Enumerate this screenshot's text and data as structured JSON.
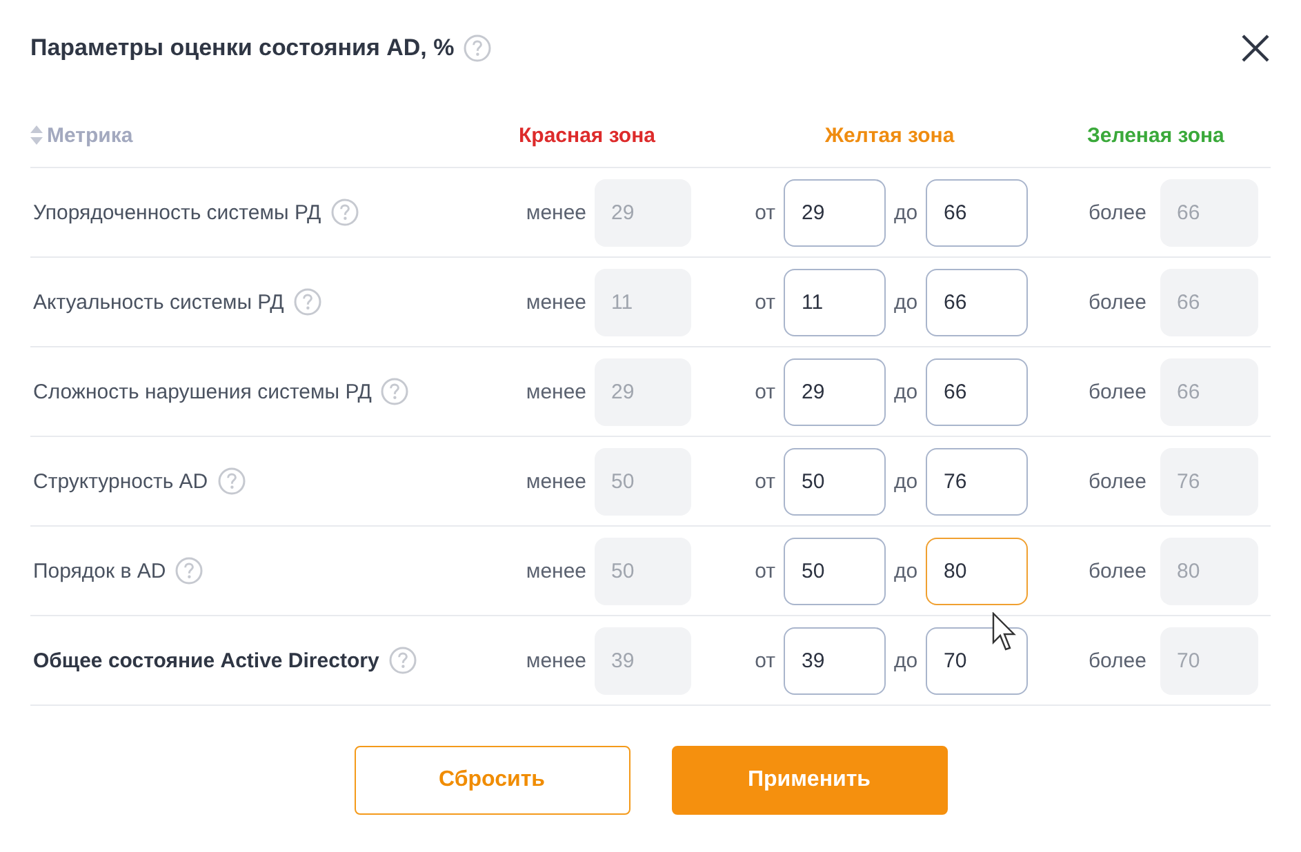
{
  "dialog": {
    "title": "Параметры оценки состояния AD, %"
  },
  "columns": [
    {
      "kind": "metric",
      "label": "Метрика"
    },
    {
      "kind": "red",
      "label": "Красная зона"
    },
    {
      "kind": "yellow",
      "label": "Желтая зона"
    },
    {
      "kind": "green",
      "label": "Зеленая зона"
    }
  ],
  "rows": [
    {
      "kind": "metric",
      "name": "Упорядоченность системы РД",
      "red_label": "менее",
      "red": "29",
      "from_label": "от",
      "from": "29",
      "to_label": "до",
      "to": "66",
      "to_focused": false,
      "green_label": "более",
      "green": "66"
    },
    {
      "kind": "metric",
      "name": "Актуальность системы РД",
      "red_label": "менее",
      "red": "11",
      "from_label": "от",
      "from": "11",
      "to_label": "до",
      "to": "66",
      "to_focused": false,
      "green_label": "более",
      "green": "66"
    },
    {
      "kind": "metric",
      "name": "Сложность нарушения системы РД",
      "red_label": "менее",
      "red": "29",
      "from_label": "от",
      "from": "29",
      "to_label": "до",
      "to": "66",
      "to_focused": false,
      "green_label": "более",
      "green": "66"
    },
    {
      "kind": "metric",
      "name": "Структурность AD",
      "red_label": "менее",
      "red": "50",
      "from_label": "от",
      "from": "50",
      "to_label": "до",
      "to": "76",
      "to_focused": false,
      "green_label": "более",
      "green": "76"
    },
    {
      "kind": "metric",
      "name": "Порядок в AD",
      "red_label": "менее",
      "red": "50",
      "from_label": "от",
      "from": "50",
      "to_label": "до",
      "to": "80",
      "to_focused": true,
      "green_label": "более",
      "green": "80"
    },
    {
      "kind": "total",
      "name": "Общее состояние Active Directory",
      "red_label": "менее",
      "red": "39",
      "from_label": "от",
      "from": "39",
      "to_label": "до",
      "to": "70",
      "to_focused": false,
      "green_label": "более",
      "green": "70"
    }
  ],
  "buttons": [
    {
      "kind": "secondary",
      "label": "Сбросить"
    },
    {
      "kind": "primary",
      "label": "Применить"
    }
  ]
}
